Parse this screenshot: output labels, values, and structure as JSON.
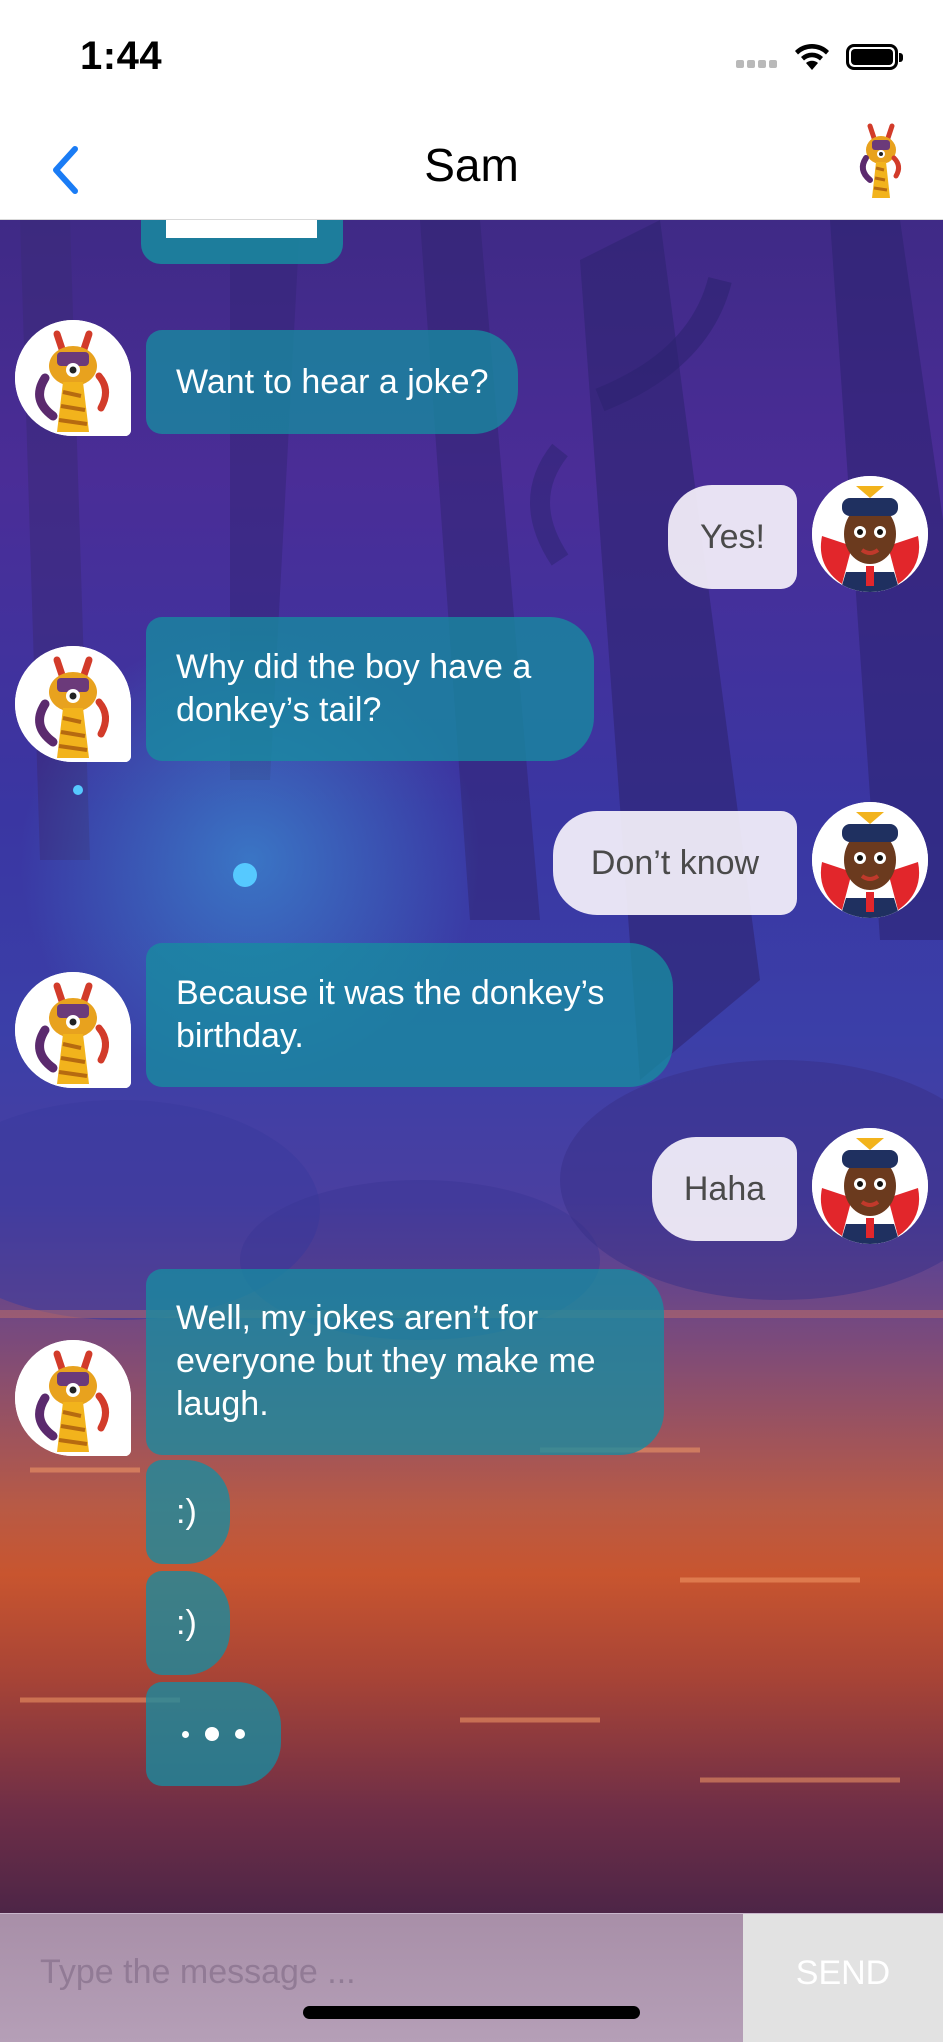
{
  "status_bar": {
    "time": "1:44"
  },
  "nav": {
    "title": "Sam",
    "back_icon": "chevron-left-icon",
    "accent_color": "#1a7cf5"
  },
  "messages": [
    {
      "from": "bot",
      "text": "Want to hear a joke?"
    },
    {
      "from": "user",
      "text": "Yes!"
    },
    {
      "from": "bot",
      "text": "Why did the boy have a donkey’s tail?"
    },
    {
      "from": "user",
      "text": "Don’t know"
    },
    {
      "from": "bot",
      "text": "Because it was the donkey’s birthday."
    },
    {
      "from": "user",
      "text": "Haha"
    },
    {
      "from": "bot",
      "text": "Well, my jokes aren’t for everyone but they make me laugh."
    },
    {
      "from": "bot",
      "text": ":)"
    },
    {
      "from": "bot",
      "text": ":)"
    },
    {
      "from": "bot",
      "typing": true
    }
  ],
  "composer": {
    "placeholder": "Type the message ...",
    "send_label": "SEND"
  },
  "colors": {
    "bot_bubble": "#178ca0",
    "user_bubble": "#f4f0fa"
  }
}
